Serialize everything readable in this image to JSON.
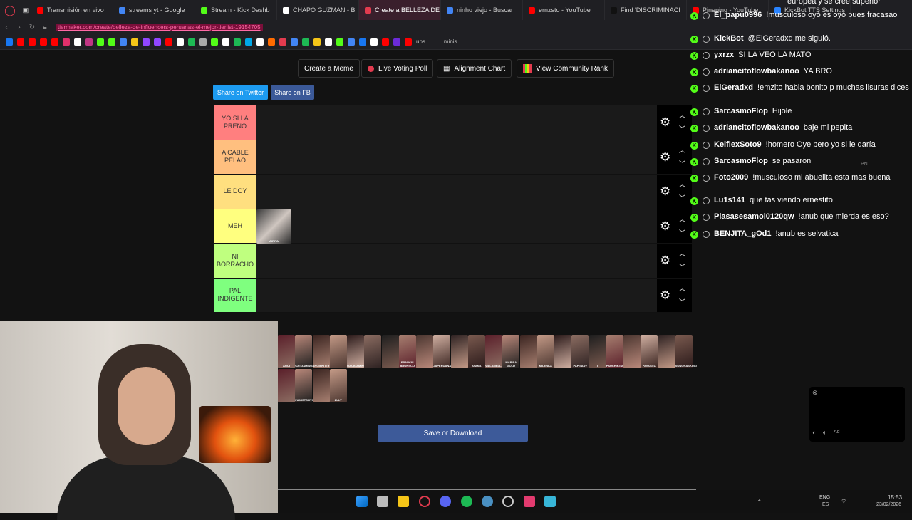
{
  "browser": {
    "tabs": [
      {
        "label": "Transmisión en vivo",
        "color": "#ff0000"
      },
      {
        "label": "streams yt - Google",
        "color": "#4285f4"
      },
      {
        "label": "Stream - Kick Dashb",
        "color": "#53fc18"
      },
      {
        "label": "CHAPO GUZMAN - B",
        "color": "#ffffff"
      },
      {
        "label": "Create a BELLEZA DE INF",
        "color": "#e33b4f",
        "active": true
      },
      {
        "label": "ninho viejo - Buscar",
        "color": "#4285f4"
      },
      {
        "label": "ernzsto - YouTube",
        "color": "#ff0000"
      },
      {
        "label": "Find 'DISCRIMINACI",
        "color": "#111111"
      },
      {
        "label": "Pineping - YouTube",
        "color": "#ff0000"
      },
      {
        "label": "KickBot TTS Settings",
        "color": "#2a84ff"
      }
    ],
    "url": "tiermaker.com/create/belleza-de-influencers-peruanas-el-mejor-tierlist-19154705",
    "bookmarks": {
      "ups": "ups",
      "minis": "minis"
    }
  },
  "page": {
    "top_buttons": {
      "meme": "Create a Meme",
      "poll": "Live Voting Poll",
      "alignment": "Alignment Chart",
      "community": "View Community Rank"
    },
    "share_twitter": "Share on Twitter",
    "share_fb": "Share on FB",
    "tiers": [
      {
        "label": "YO SI LA PREÑO",
        "color": "#ff7f7f"
      },
      {
        "label": "A CABLE PELAO",
        "color": "#ffbf7f"
      },
      {
        "label": "LE DOY",
        "color": "#ffdf7f"
      },
      {
        "label": "MEH",
        "color": "#ffff7f"
      },
      {
        "label": "NI BORRACHO",
        "color": "#bfff7f"
      },
      {
        "label": "PAL INDIGENTE",
        "color": "#7fff7f"
      }
    ],
    "placed_item": {
      "tier": "MEH",
      "label": "AIRITA"
    },
    "pool_items": [
      "AGUI",
      "CATGAMING",
      "ANGIEKITTY",
      "",
      "GACIGAMING",
      "",
      "",
      "FRANCIS BRONSCO",
      "",
      "JAPERUANA",
      "",
      "AYANA",
      "VILLAMELLA",
      "MARISA GOLD",
      "",
      "MILENKA",
      "",
      "PAPITASV",
      "T",
      "PAUCHIKITA",
      "",
      "PAVASITA",
      "",
      "SONORASKING",
      "",
      "PAMISTORYONT",
      "",
      "ZULY"
    ],
    "save_button": "Save or Download"
  },
  "chat": [
    {
      "user": "",
      "text": "europea y se cree superior",
      "user_color": "#ffffff"
    },
    {
      "user": "El_papu0996",
      "text": "!musculoso oyó es oyó pues fracasao",
      "user_color": "#ffffff"
    },
    {
      "user": "KickBot",
      "text": "@ElGeradxd me siguió.",
      "user_color": "#ffffff"
    },
    {
      "user": "yxrzx",
      "text": "SI LA VEO LA MATO",
      "user_color": "#ffffff"
    },
    {
      "user": "adriancitoflowbakanoo",
      "text": "YA BRO",
      "user_color": "#ffffff"
    },
    {
      "user": "ElGeradxd",
      "text": "!emzito habla bonito p muchas lisuras dices",
      "user_color": "#ffffff"
    },
    {
      "user": "SarcasmoFlop",
      "text": "Hijole",
      "user_color": "#ffffff"
    },
    {
      "user": "adriancitoflowbakanoo",
      "text": "baje mi pepita",
      "user_color": "#ffffff"
    },
    {
      "user": "KeiflexSoto9",
      "text": "!homero Oye pero yo si le daría",
      "user_color": "#ffffff"
    },
    {
      "user": "SarcasmoFlop",
      "text": "se pasaron",
      "user_color": "#ffffff"
    },
    {
      "user": "Foto2009",
      "text": "!musculoso mi abuelita esta mas buena",
      "user_color": "#ffffff"
    },
    {
      "user": "Lu1s141",
      "text": "que tas viendo ernestito",
      "user_color": "#ffffff"
    },
    {
      "user": "Plasasesamoi0120qw",
      "text": "!anub que mierda es eso?",
      "user_color": "#ffffff"
    },
    {
      "user": "BENJITA_gOd1",
      "text": "!anub es selvatica",
      "user_color": "#ffffff"
    }
  ],
  "chat_overlay": {
    "pn_label": "PN",
    "ad_label": "Ad"
  },
  "taskbar": {
    "lang": "ENG",
    "lang2": "ES",
    "time": "15:53",
    "date": "23/02/2026"
  }
}
